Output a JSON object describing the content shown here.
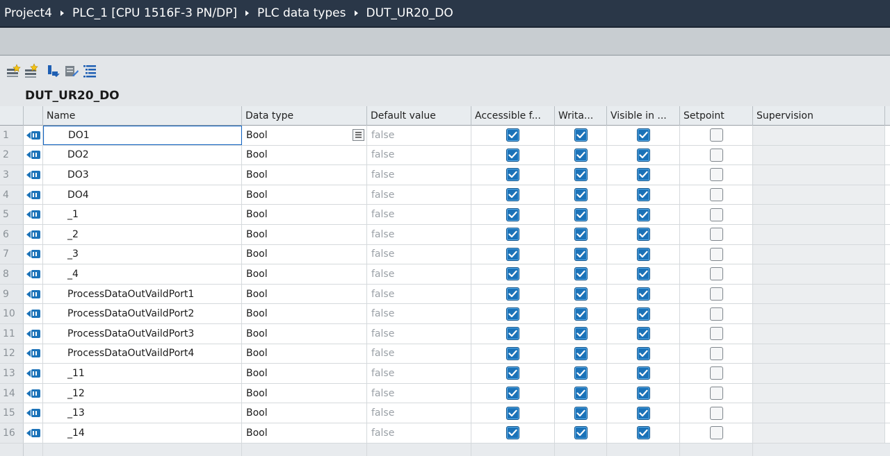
{
  "breadcrumb": [
    "Project4",
    "PLC_1 [CPU 1516F-3 PN/DP]",
    "PLC data types",
    "DUT_UR20_DO"
  ],
  "toolbar": {
    "buttons": [
      {
        "name": "insert-row-icon"
      },
      {
        "name": "add-row-icon"
      },
      {
        "name": "expand-icon"
      },
      {
        "name": "edit-icon"
      },
      {
        "name": "list-view-icon"
      }
    ]
  },
  "type_name": "DUT_UR20_DO",
  "columns": [
    "Name",
    "Data type",
    "Default value",
    "Accessible f...",
    "Writa...",
    "Visible in ...",
    "Setpoint",
    "Supervision"
  ],
  "rows": [
    {
      "num": "1",
      "name": "DO1",
      "type": "Bool",
      "default": "false",
      "accessible": true,
      "writable": true,
      "visible": true,
      "setpoint": false
    },
    {
      "num": "2",
      "name": "DO2",
      "type": "Bool",
      "default": "false",
      "accessible": true,
      "writable": true,
      "visible": true,
      "setpoint": false
    },
    {
      "num": "3",
      "name": "DO3",
      "type": "Bool",
      "default": "false",
      "accessible": true,
      "writable": true,
      "visible": true,
      "setpoint": false
    },
    {
      "num": "4",
      "name": "DO4",
      "type": "Bool",
      "default": "false",
      "accessible": true,
      "writable": true,
      "visible": true,
      "setpoint": false
    },
    {
      "num": "5",
      "name": "_1",
      "type": "Bool",
      "default": "false",
      "accessible": true,
      "writable": true,
      "visible": true,
      "setpoint": false
    },
    {
      "num": "6",
      "name": "_2",
      "type": "Bool",
      "default": "false",
      "accessible": true,
      "writable": true,
      "visible": true,
      "setpoint": false
    },
    {
      "num": "7",
      "name": "_3",
      "type": "Bool",
      "default": "false",
      "accessible": true,
      "writable": true,
      "visible": true,
      "setpoint": false
    },
    {
      "num": "8",
      "name": "_4",
      "type": "Bool",
      "default": "false",
      "accessible": true,
      "writable": true,
      "visible": true,
      "setpoint": false
    },
    {
      "num": "9",
      "name": "ProcessDataOutVaildPort1",
      "type": "Bool",
      "default": "false",
      "accessible": true,
      "writable": true,
      "visible": true,
      "setpoint": false
    },
    {
      "num": "10",
      "name": "ProcessDataOutVaildPort2",
      "type": "Bool",
      "default": "false",
      "accessible": true,
      "writable": true,
      "visible": true,
      "setpoint": false
    },
    {
      "num": "11",
      "name": "ProcessDataOutVaildPort3",
      "type": "Bool",
      "default": "false",
      "accessible": true,
      "writable": true,
      "visible": true,
      "setpoint": false
    },
    {
      "num": "12",
      "name": "ProcessDataOutVaildPort4",
      "type": "Bool",
      "default": "false",
      "accessible": true,
      "writable": true,
      "visible": true,
      "setpoint": false
    },
    {
      "num": "13",
      "name": "_11",
      "type": "Bool",
      "default": "false",
      "accessible": true,
      "writable": true,
      "visible": true,
      "setpoint": false
    },
    {
      "num": "14",
      "name": "_12",
      "type": "Bool",
      "default": "false",
      "accessible": true,
      "writable": true,
      "visible": true,
      "setpoint": false
    },
    {
      "num": "15",
      "name": "_13",
      "type": "Bool",
      "default": "false",
      "accessible": true,
      "writable": true,
      "visible": true,
      "setpoint": false
    },
    {
      "num": "16",
      "name": "_14",
      "type": "Bool",
      "default": "false",
      "accessible": true,
      "writable": true,
      "visible": true,
      "setpoint": false
    }
  ],
  "colors": {
    "title_bar": "#2a3748",
    "checkbox_on": "#1b72b8",
    "selection": "#1565c0"
  }
}
